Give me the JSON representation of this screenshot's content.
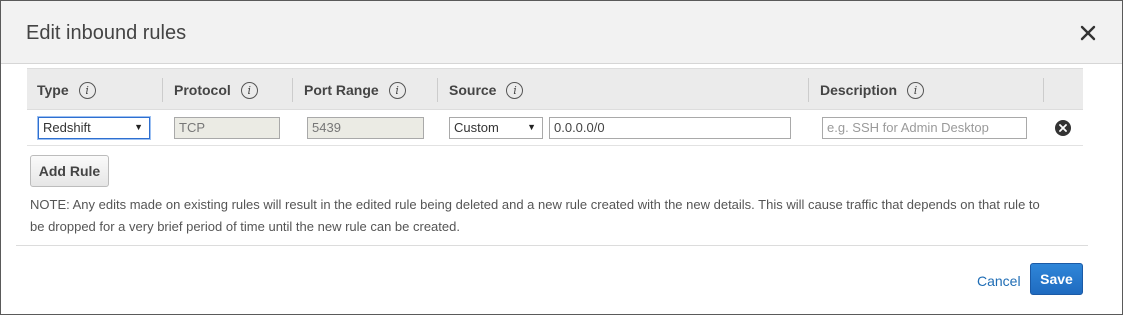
{
  "dialog": {
    "title": "Edit inbound rules",
    "close_icon": "close-x-icon"
  },
  "table": {
    "columns": [
      {
        "label": "Type",
        "info_icon": "i"
      },
      {
        "label": "Protocol",
        "info_icon": "i"
      },
      {
        "label": "Port Range",
        "info_icon": "i"
      },
      {
        "label": "Source",
        "info_icon": "i"
      },
      {
        "label": "Description",
        "info_icon": "i"
      }
    ],
    "rows": [
      {
        "type": "Redshift",
        "protocol": "TCP",
        "port_range": "5439",
        "source_type": "Custom",
        "source_value": "0.0.0.0/0",
        "description_placeholder": "e.g. SSH for Admin Desktop",
        "remove_icon": "remove-circle-icon"
      }
    ]
  },
  "add_rule_label": "Add Rule",
  "note": "NOTE: Any edits made on existing rules will result in the edited rule being deleted and a new rule created with the new details. This will cause traffic that depends on that rule to be dropped for a very brief period of time until the new rule can be created.",
  "footer": {
    "cancel_label": "Cancel",
    "save_label": "Save"
  },
  "colors": {
    "accent": "#1f6bc0",
    "link": "#1f6db5"
  }
}
